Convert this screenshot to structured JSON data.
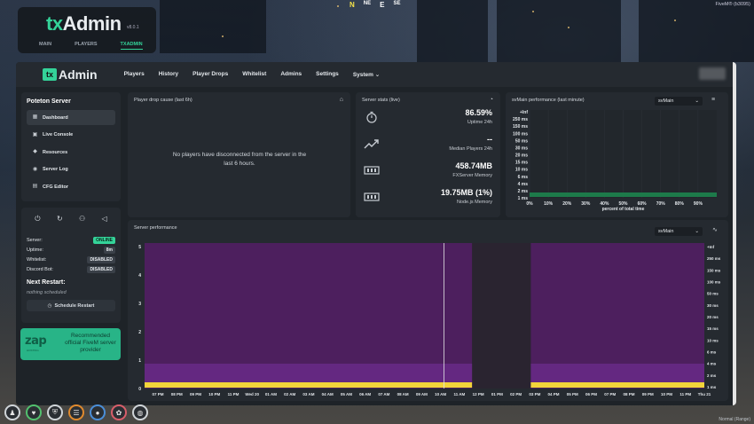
{
  "game": {
    "compass": [
      "N",
      "NE",
      "E",
      "SE"
    ],
    "player_tag": "FiveM® (b3095)",
    "bottom_right": "Normal (Range)"
  },
  "menu_widget": {
    "logo_prefix": "tx",
    "logo_rest": "Admin",
    "version": "v8.0.1",
    "tabs": [
      "MAIN",
      "PLAYERS",
      "TXADMIN"
    ],
    "active_tab": "TXADMIN"
  },
  "topnav": {
    "brand_box": "tx",
    "brand_text": "Admin",
    "links": [
      "Players",
      "History",
      "Player Drops",
      "Whitelist",
      "Admins",
      "Settings",
      "System ⌄"
    ]
  },
  "sidebar": {
    "server_name": "Poteton Server",
    "items": [
      {
        "label": "Dashboard",
        "icon": "dashboard-icon",
        "active": true
      },
      {
        "label": "Live Console",
        "icon": "console-icon"
      },
      {
        "label": "Resources",
        "icon": "resources-icon"
      },
      {
        "label": "Server Log",
        "icon": "eye-icon"
      },
      {
        "label": "CFG Editor",
        "icon": "file-icon"
      }
    ],
    "status": {
      "server_label": "Server:",
      "server_value": "ONLINE",
      "uptime_label": "Uptime:",
      "uptime_value": "8m",
      "whitelist_label": "Whitelist:",
      "whitelist_value": "DISABLED",
      "discord_label": "Discord Bot:",
      "discord_value": "DISABLED"
    },
    "next_restart_title": "Next Restart:",
    "next_restart_value": "nothing scheduled",
    "schedule_button": "Schedule Restart"
  },
  "zap": {
    "logo": "zap",
    "small": "HOSTING",
    "text": "Recommended official FiveM server provider"
  },
  "drop_panel": {
    "title": "Player drop cause (last 6h)",
    "message": "No players have disconnected from the server in the last 6 hours."
  },
  "stats_panel": {
    "title": "Server stats (live)",
    "items": [
      {
        "value": "86.59%",
        "label": "Uptime 24h"
      },
      {
        "value": "--",
        "label": "Median Players 24h"
      },
      {
        "value": "458.74MB",
        "label": "FXServer Memory"
      },
      {
        "value": "19.75MB (1%)",
        "label": "Node.js Memory"
      }
    ]
  },
  "svmain_panel": {
    "title": "svMain performance (last minute)",
    "select": "svMain",
    "y_labels": [
      "+Inf",
      "250 ms",
      "150 ms",
      "100 ms",
      "50 ms",
      "30 ms",
      "20 ms",
      "15 ms",
      "10 ms",
      "6 ms",
      "4 ms",
      "2 ms",
      "1 ms"
    ],
    "x_labels": [
      "0%",
      "10%",
      "20%",
      "30%",
      "40%",
      "50%",
      "60%",
      "70%",
      "80%",
      "90%"
    ],
    "x_title": "percent of total time"
  },
  "server_perf_panel": {
    "title": "Server performance",
    "select": "svMain",
    "left_y_labels": [
      "5",
      "4",
      "3",
      "2",
      "1",
      "0"
    ],
    "right_y_labels": [
      "+Inf",
      "250 ms",
      "150 ms",
      "100 ms",
      "50 ms",
      "30 ms",
      "20 ms",
      "15 ms",
      "10 ms",
      "6 ms",
      "4 ms",
      "2 ms",
      "1 ms"
    ],
    "x_labels": [
      "07 PM",
      "08 PM",
      "09 PM",
      "10 PM",
      "11 PM",
      "Wed 20",
      "01 AM",
      "02 AM",
      "03 AM",
      "04 AM",
      "05 AM",
      "06 AM",
      "07 AM",
      "08 AM",
      "09 AM",
      "10 AM",
      "11 AM",
      "12 PM",
      "01 PM",
      "02 PM",
      "03 PM",
      "04 PM",
      "05 PM",
      "06 PM",
      "07 PM",
      "08 PM",
      "09 PM",
      "10 PM",
      "11 PM",
      "Thu 21"
    ]
  }
}
